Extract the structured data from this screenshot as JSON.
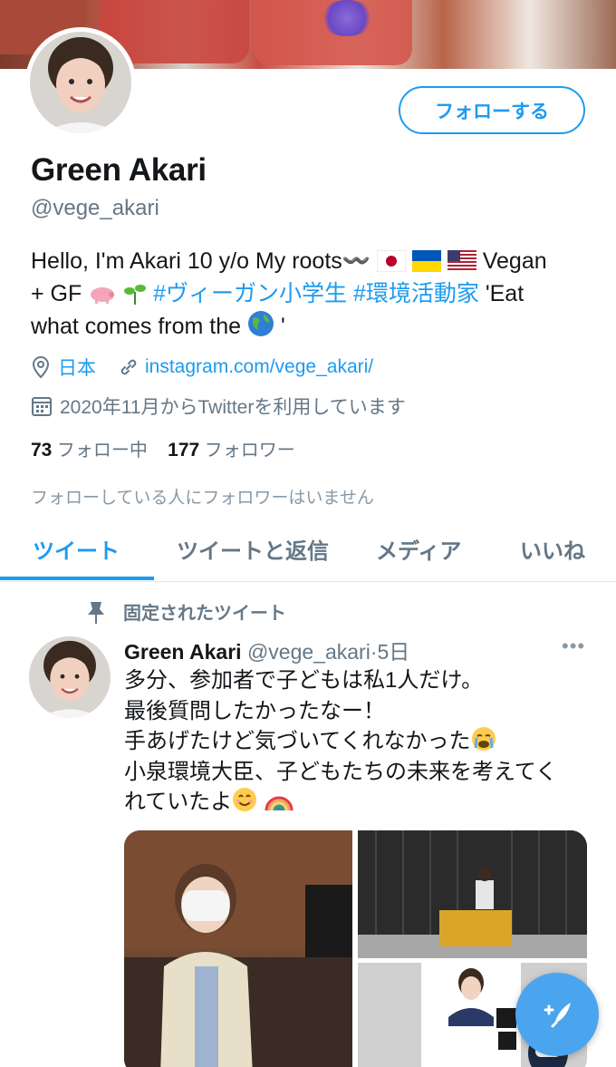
{
  "profile": {
    "name": "Green Akari",
    "handle": "@vege_akari",
    "follow_label": "フォローする",
    "bio_text1": "Hello, I'm Akari 10 y/o My roots〰️",
    "bio_vegan": "Vegan",
    "bio_gf": "+ GF",
    "bio_tag1": "#ヴィーガン小学生",
    "bio_tag2": "#環境活動家",
    "bio_eat": "'Eat",
    "bio_what": "what comes from the",
    "bio_quote_end": "'",
    "location": "日本",
    "website": "instagram.com/vege_akari/",
    "joined": "2020年11月からTwitterを利用しています",
    "following_count": "73",
    "following_label": "フォロー中",
    "followers_count": "177",
    "followers_label": "フォロワー",
    "no_mutual": "フォローしている人にフォロワーはいません"
  },
  "tabs": {
    "tweets": "ツイート",
    "replies": "ツイートと返信",
    "media": "メディア",
    "likes": "いいね"
  },
  "tweet": {
    "pinned_label": "固定されたツイート",
    "name": "Green Akari",
    "handle": "@vege_akari",
    "time": "·5日",
    "more": "•••",
    "line1": "多分、参加者で子どもは私1人だけ。",
    "line2": "最後質問したかったなー！",
    "line3": "手あげたけど気づいてくれなかった",
    "line4": "小泉環境大臣、子どもたちの未来を考えてく",
    "line5": "れていたよ"
  },
  "colors": {
    "accent": "#1d9bf0",
    "secondary": "#657786",
    "compose": "#4aa5ee"
  },
  "icons": [
    "location-icon",
    "link-icon",
    "calendar-icon",
    "pin-icon",
    "compose-tweet-icon"
  ]
}
